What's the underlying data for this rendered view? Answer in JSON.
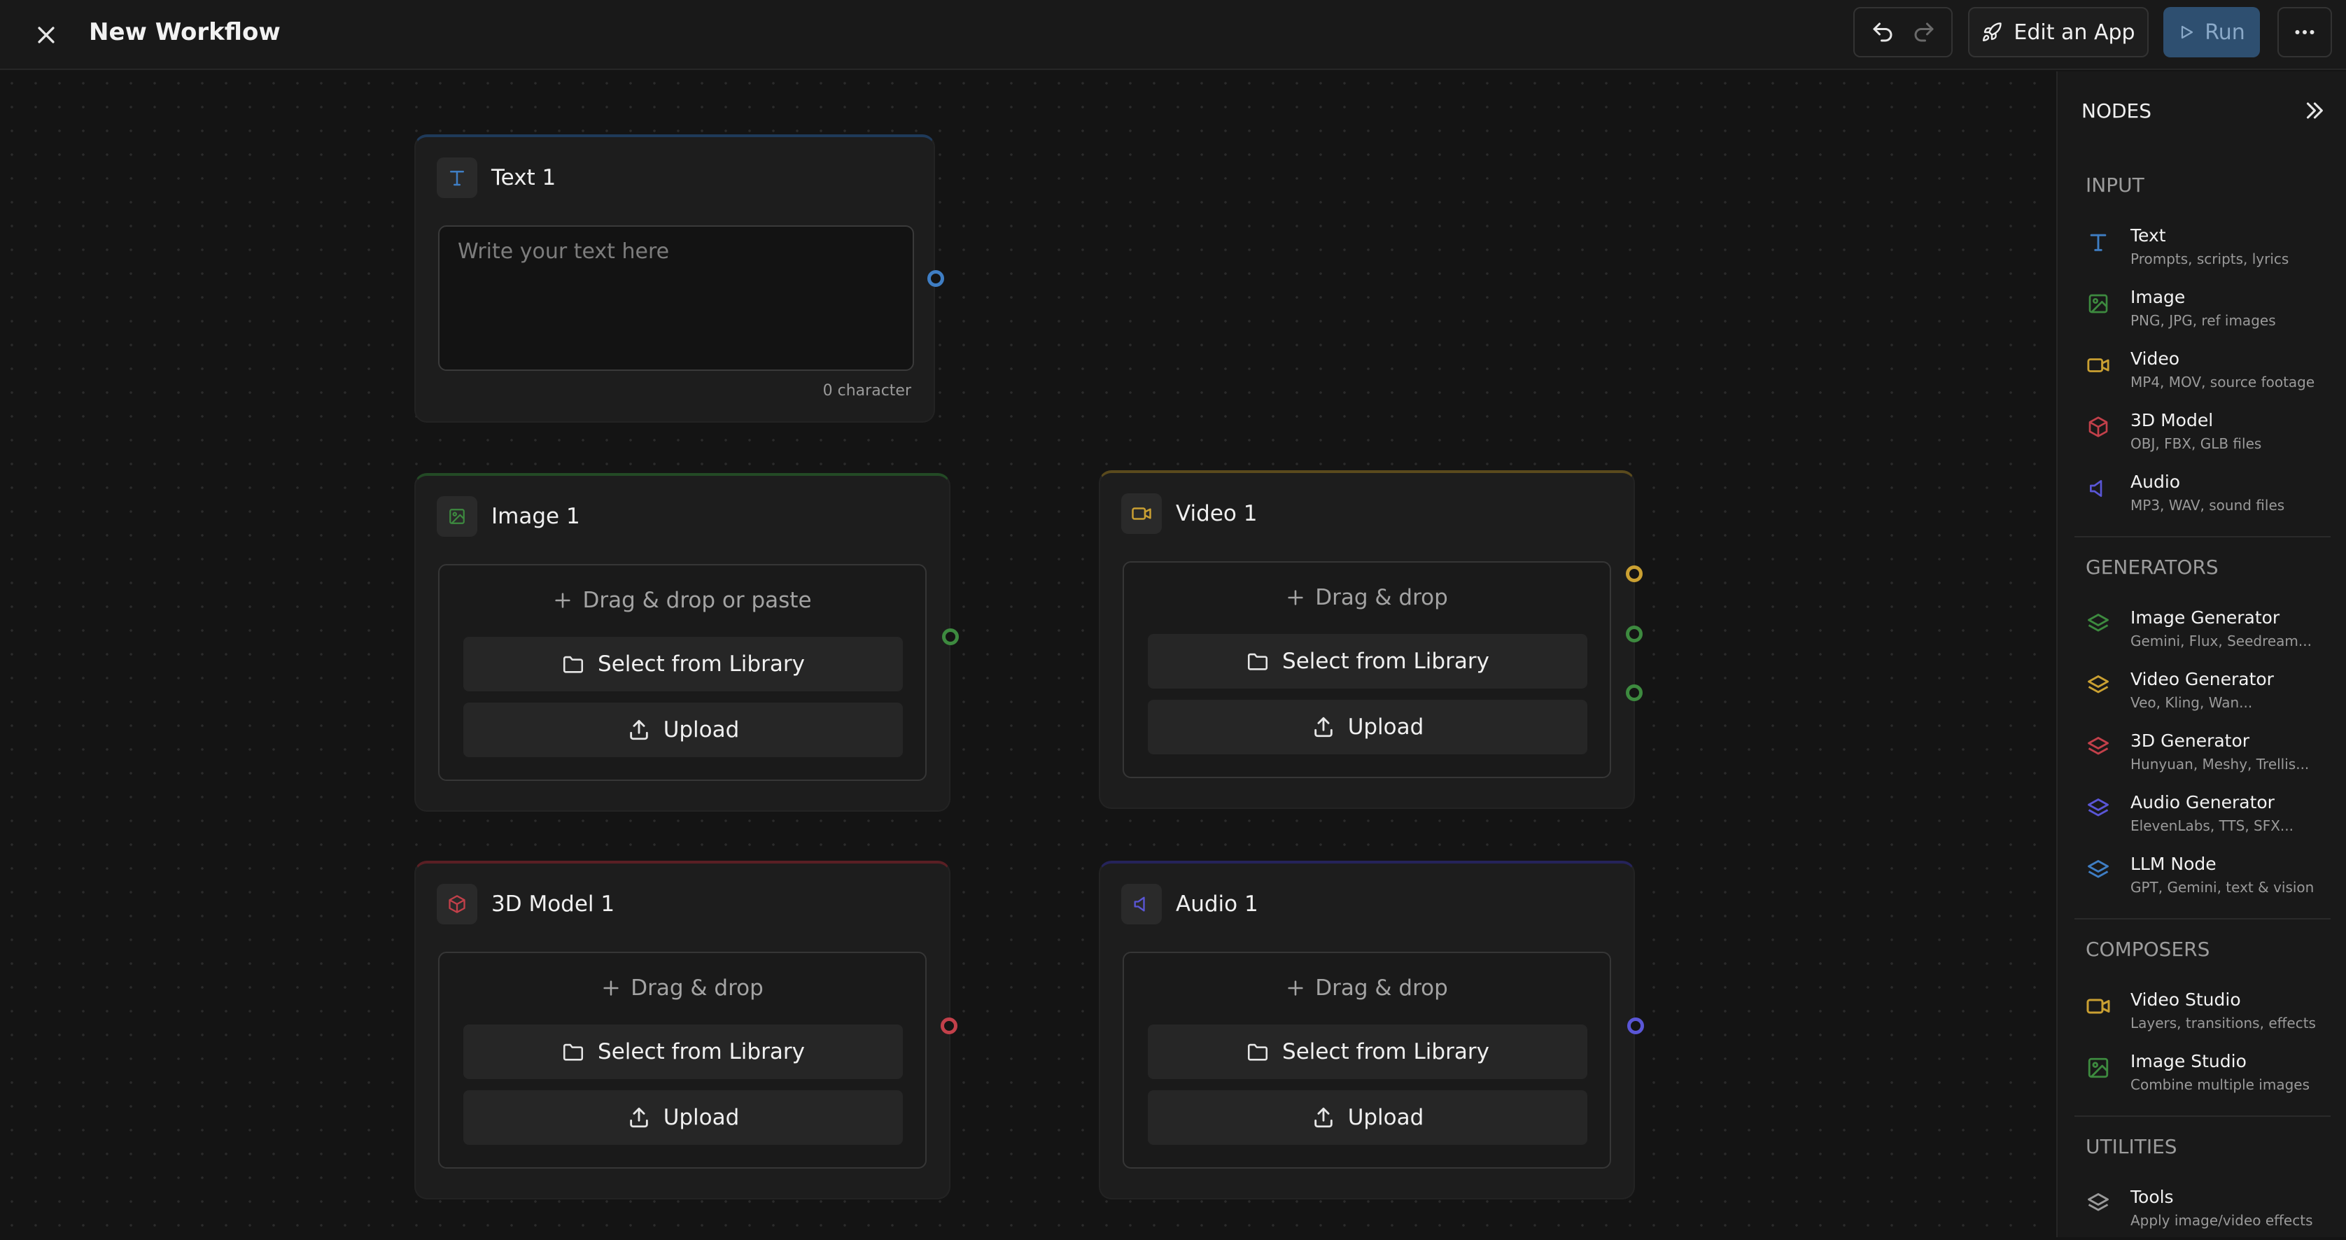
{
  "header": {
    "title": "New Workflow",
    "edit_app_label": "Edit an App",
    "run_label": "Run"
  },
  "nodes": {
    "text": {
      "title": "Text 1",
      "placeholder": "Write your text here",
      "char_count": "0 character",
      "color": "#3f7ec4"
    },
    "image": {
      "title": "Image 1",
      "drop_label": "Drag & drop or paste",
      "library_label": "Select from Library",
      "upload_label": "Upload",
      "color": "#3d8a3f"
    },
    "video": {
      "title": "Video 1",
      "drop_label": "Drag & drop",
      "library_label": "Select from Library",
      "upload_label": "Upload",
      "color": "#caa032"
    },
    "model3d": {
      "title": "3D Model 1",
      "drop_label": "Drag & drop",
      "library_label": "Select from Library",
      "upload_label": "Upload",
      "color": "#c2404a"
    },
    "audio": {
      "title": "Audio 1",
      "drop_label": "Drag & drop",
      "library_label": "Select from Library",
      "upload_label": "Upload",
      "color": "#5a56d6"
    }
  },
  "sidebar": {
    "title": "NODES",
    "sections": {
      "input": "INPUT",
      "generators": "GENERATORS",
      "composers": "COMPOSERS",
      "utilities": "UTILITIES"
    },
    "input_items": [
      {
        "name": "Text",
        "desc": "Prompts, scripts, lyrics",
        "icon": "text-icon"
      },
      {
        "name": "Image",
        "desc": "PNG, JPG, ref images",
        "icon": "image-icon"
      },
      {
        "name": "Video",
        "desc": "MP4, MOV, source footage",
        "icon": "video-icon"
      },
      {
        "name": "3D Model",
        "desc": "OBJ, FBX, GLB files",
        "icon": "cube-icon"
      },
      {
        "name": "Audio",
        "desc": "MP3, WAV, sound files",
        "icon": "speaker-icon"
      }
    ],
    "generator_items": [
      {
        "name": "Image Generator",
        "desc": "Gemini, Flux, Seedream...",
        "icon": "layers-icon"
      },
      {
        "name": "Video Generator",
        "desc": "Veo, Kling, Wan...",
        "icon": "layers-icon"
      },
      {
        "name": "3D Generator",
        "desc": "Hunyuan, Meshy, Trellis...",
        "icon": "layers-icon"
      },
      {
        "name": "Audio Generator",
        "desc": "ElevenLabs, TTS, SFX...",
        "icon": "layers-icon"
      },
      {
        "name": "LLM Node",
        "desc": "GPT, Gemini, text & vision",
        "icon": "layers-icon"
      }
    ],
    "composer_items": [
      {
        "name": "Video Studio",
        "desc": "Layers, transitions, effects",
        "icon": "video-icon"
      },
      {
        "name": "Image Studio",
        "desc": "Combine multiple images",
        "icon": "image-icon"
      }
    ],
    "utility_items": [
      {
        "name": "Tools",
        "desc": "Apply image/video effects",
        "icon": "layers-icon"
      }
    ]
  }
}
